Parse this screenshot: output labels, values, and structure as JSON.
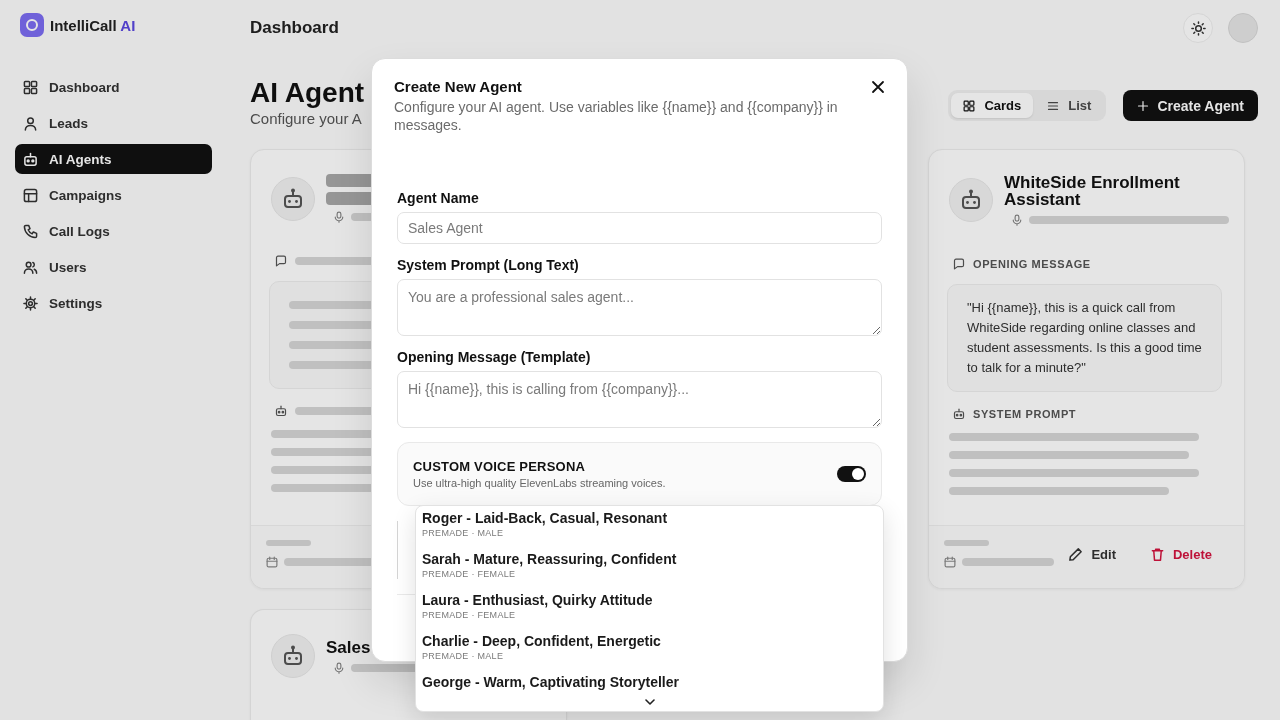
{
  "sidebar": {
    "logo": {
      "name": "IntelliCall",
      "accent": "AI"
    },
    "items": [
      {
        "label": "Dashboard",
        "selected": false
      },
      {
        "label": "Leads",
        "selected": false
      },
      {
        "label": "AI Agents",
        "selected": true
      },
      {
        "label": "Campaigns",
        "selected": false
      },
      {
        "label": "Call Logs",
        "selected": false
      },
      {
        "label": "Users",
        "selected": false
      },
      {
        "label": "Settings",
        "selected": false
      }
    ]
  },
  "header": {
    "title": "Dashboard"
  },
  "page": {
    "title": "AI Agent",
    "subtitle": "Configure your A",
    "view_toggle": [
      {
        "label": "Cards",
        "selected": true
      },
      {
        "label": "List",
        "selected": false
      }
    ],
    "create_button": "Create Agent"
  },
  "agent_cards": [
    {
      "kind": "obscured"
    },
    {
      "kind": "detailed",
      "title": "WhiteSide Enrollment Assistant",
      "sections": [
        {
          "kind": "quote",
          "label": "OPENING MESSAGE",
          "text": "\"Hi {{name}}, this is a quick call from WhiteSide regarding online classes and student assessments. Is this a good time to talk for a minute?\""
        },
        {
          "kind": "prompt",
          "label": "SYSTEM PROMPT"
        }
      ],
      "actions": [
        {
          "kind": "edit",
          "label": "Edit"
        },
        {
          "kind": "delete",
          "label": "Delete"
        }
      ]
    },
    {
      "kind": "peek",
      "title": "Sales"
    }
  ],
  "modal": {
    "title": "Create New Agent",
    "description": "Configure your AI agent. Use variables like {{name}} and {{company}} in messages.",
    "fields": [
      {
        "kind": "input",
        "label": "Agent Name",
        "placeholder": "Sales Agent"
      },
      {
        "kind": "textarea",
        "label": "System Prompt (Long Text)",
        "placeholder": "You are a professional sales agent..."
      },
      {
        "kind": "textarea",
        "label": "Opening Message (Template)",
        "placeholder": "Hi {{name}}, this is calling from {{company}}..."
      }
    ],
    "voice_persona": {
      "title": "CUSTOM VOICE PERSONA",
      "description": "Use ultra-high quality ElevenLabs streaming voices.",
      "on": true
    },
    "voice_menu": {
      "options": [
        {
          "name": "Roger - Laid-Back, Casual, Resonant",
          "details": "PREMADE · MALE",
          "selected": false
        },
        {
          "name": "Sarah - Mature, Reassuring, Confident",
          "details": "PREMADE · FEMALE",
          "selected": false
        },
        {
          "name": "Laura - Enthusiast, Quirky Attitude",
          "details": "PREMADE · FEMALE",
          "selected": false
        },
        {
          "name": "Charlie - Deep, Confident, Energetic",
          "details": "PREMADE · MALE",
          "selected": false
        },
        {
          "name": "George - Warm, Captivating Storyteller",
          "selected": false
        }
      ]
    }
  }
}
